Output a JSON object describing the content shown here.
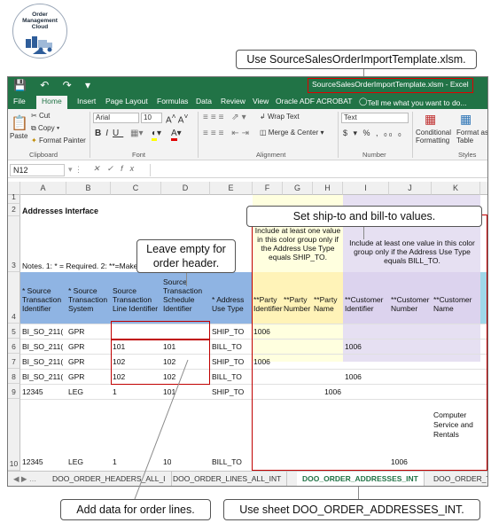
{
  "logo": {
    "line1": "Order",
    "line2": "Management",
    "line3": "Cloud"
  },
  "callouts": {
    "template": "Use SourceSalesOrderImportTemplate.xlsm.",
    "ship_bill": "Set ship-to and bill-to values.",
    "leave_empty": "Leave  empty for order header.",
    "order_lines": "Add data for order lines.",
    "sheet": "Use sheet DOO_ORDER_ADDRESSES_INT."
  },
  "excel": {
    "window_title": "SourceSalesOrderImportTemplate.xlsm - Excel",
    "menu": [
      "File",
      "Home",
      "Insert",
      "Page Layout",
      "Formulas",
      "Data",
      "Review",
      "View",
      "Oracle ADF",
      "ACROBAT",
      "Tell me what you want to do..."
    ],
    "ribbon": {
      "paste": "Paste",
      "cut": "Cut",
      "copy": "Copy",
      "format_painter": "Format Painter",
      "clipboard": "Clipboard",
      "font_name": "Arial",
      "font_size": "10",
      "font_group": "Font",
      "wrap_text": "Wrap Text",
      "merge_center": "Merge & Center",
      "alignment": "Alignment",
      "number_format": "Text",
      "number": "Number",
      "conditional": "Conditional",
      "formatting": "Formatting",
      "format_as": "Format as",
      "table": "Table",
      "styles": "Styles"
    },
    "name_box": "N12",
    "fx": "fx",
    "columns": [
      "A",
      "B",
      "C",
      "D",
      "E",
      "F",
      "G",
      "H",
      "I",
      "J",
      "K"
    ],
    "rows": [
      "1",
      "2",
      "3",
      "4",
      "5",
      "6",
      "7",
      "8",
      "9",
      "10"
    ],
    "a2": "Addresses Interface",
    "a3": "Notes. 1: * = Required. 2: **=Make sure you include at least one",
    "ship_note": "Include at least one value in this color group only if the Address Use Type equals SHIP_TO.",
    "bill_note": "Include at least one value in this color group only if the Address Use Type equals BILL_TO.",
    "headers": [
      "* Source Transaction Identifier",
      "* Source Transaction System",
      "Source Transaction Line Identifier",
      "Source Transaction Schedule Identifier",
      "* Address Use Type",
      "**Party Identifier",
      "**Party Number",
      "**Party Name",
      "**Customer Identifier",
      "**Customer Number",
      "**Customer Name"
    ],
    "data_rows": [
      [
        "BI_SO_211(",
        "GPR",
        "",
        "",
        "SHIP_TO",
        "1006",
        "",
        "",
        "",
        "",
        ""
      ],
      [
        "BI_SO_211(",
        "GPR",
        "101",
        "101",
        "BILL_TO",
        "",
        "",
        "",
        "1006",
        "",
        ""
      ],
      [
        "BI_SO_211(",
        "GPR",
        "102",
        "102",
        "SHIP_TO",
        "1006",
        "",
        "",
        "",
        "",
        ""
      ],
      [
        "BI_SO_211(",
        "GPR",
        "102",
        "102",
        "BILL_TO",
        "",
        "",
        "",
        "1006",
        "",
        ""
      ],
      [
        "12345",
        "LEG",
        "1",
        "101",
        "SHIP_TO",
        "",
        "",
        "1006",
        "",
        "",
        ""
      ],
      [
        "12345",
        "LEG",
        "1",
        "10",
        "BILL_TO",
        "",
        "",
        "",
        "",
        "1006",
        "Computer Service and Rentals"
      ]
    ],
    "sheet_tabs": [
      "DOO_ORDER_HEADERS_ALL_I",
      "DOO_ORDER_LINES_ALL_INT",
      "DOO_ORDER_ADDRESSES_INT",
      "DOO_ORDER_TX"
    ],
    "active_tab": "DOO_ORDER_ADDRESSES_INT"
  },
  "colors": {
    "excel_green": "#217346",
    "header_blue": "#8fb4e3",
    "ship_yellow": "#ffffdf",
    "bill_lavender": "#e6e0f2",
    "callout_red": "#c00000"
  }
}
